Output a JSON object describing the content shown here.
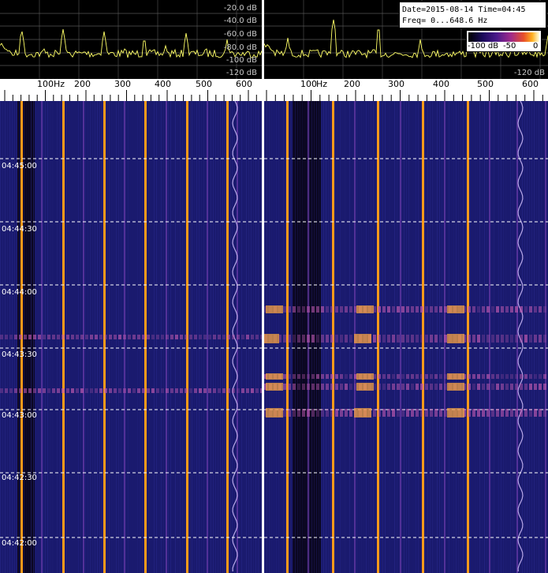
{
  "info": {
    "date_time": "Date=2015-08-14 Time=04:45",
    "freq": "Freq= 0...648.6 Hz"
  },
  "colorbar": {
    "min_label": "-100 dB",
    "mid_label": "-50",
    "max_label": "0"
  },
  "spectrum": {
    "db_labels": [
      "-20.0 dB",
      "-40.0 dB",
      "-60.0 dB",
      "-80.0 dB",
      "-100 dB",
      "-120 dB"
    ],
    "db_labels_right": [
      "-120 dB"
    ]
  },
  "scale": {
    "unit": "Hz",
    "ticks": [
      "100",
      "200",
      "300",
      "400",
      "500",
      "600"
    ]
  },
  "times": [
    "04:45:00",
    "04:44:30",
    "04:44:00",
    "04:43:30",
    "04:43:00",
    "04:42:30",
    "04:42:00"
  ],
  "colors": {
    "waterfall_bg": "#1a1a6e",
    "trace": "#ffff66",
    "line_orange": "#ff9a1a",
    "grid": "#808080"
  }
}
